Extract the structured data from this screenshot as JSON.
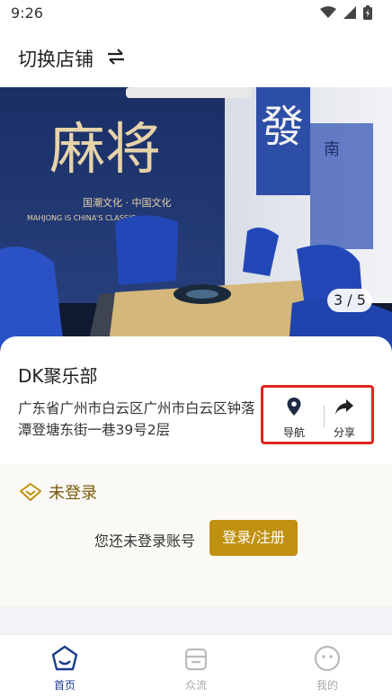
{
  "status_bar": {
    "time": "9:26"
  },
  "header": {
    "title": "切换店铺",
    "swap_icon": "swap-arrows-icon"
  },
  "carousel": {
    "counter": "3 / 5",
    "poster_text": {
      "main": "麻将",
      "sub1": "国潮文化 · 中国文化",
      "sub2": "MAHJONG IS CHINA'S CLASSIC",
      "tile": "發",
      "side": "南"
    }
  },
  "store": {
    "name": "DK聚乐部",
    "address": "广东省广州市白云区广州市白云区钟落潭登塘东街一巷39号2层",
    "actions": {
      "navigate": "导航",
      "share": "分享"
    }
  },
  "login": {
    "tag": "未登录",
    "prompt": "您还未登录账号",
    "button": "登录/注册",
    "accent_color": "#c09010"
  },
  "tabs": [
    {
      "label": "首页",
      "icon": "home-face-icon",
      "active": true
    },
    {
      "label": "众流",
      "icon": "shop-icon",
      "active": false
    },
    {
      "label": "我的",
      "icon": "profile-face-icon",
      "active": false
    }
  ]
}
